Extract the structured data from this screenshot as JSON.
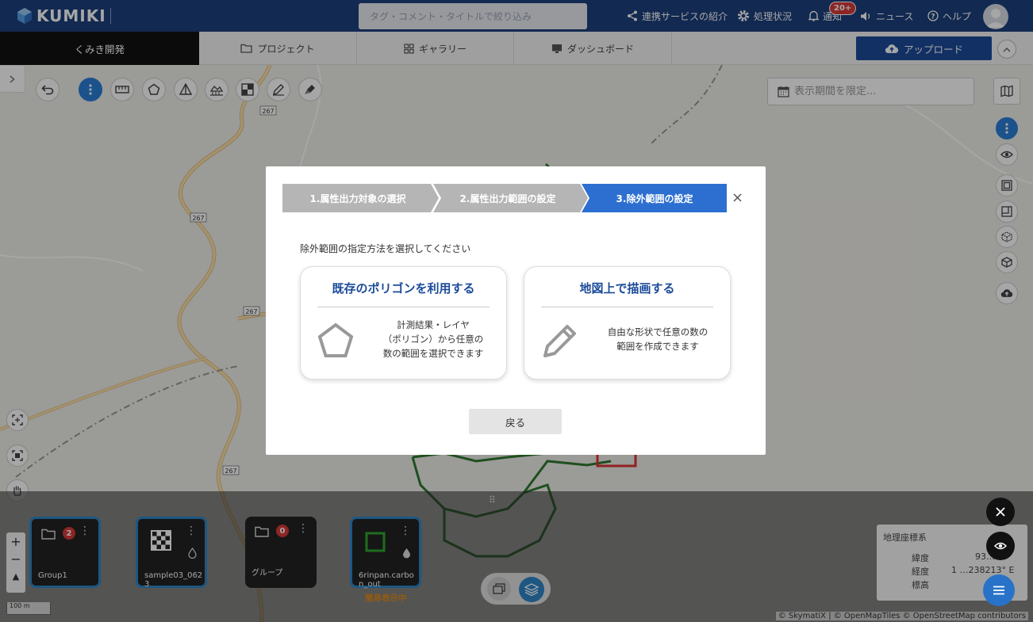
{
  "header": {
    "brand": "KUMIKI",
    "search_placeholder": "タグ・コメント・タイトルで絞り込み",
    "nav": {
      "services": "連携サービスの紹介",
      "status": "処理状況",
      "notifications": "通知",
      "notifications_badge": "20+",
      "news": "ニュース",
      "help": "ヘルプ"
    }
  },
  "tabs": {
    "project_name": "くみき開発",
    "project": "プロジェクト",
    "gallery": "ギャラリー",
    "dashboard": "ダッシュボード",
    "upload": "アップロード"
  },
  "map": {
    "date_placeholder": "表示期間を限定...",
    "road_labels": [
      "267",
      "267",
      "267",
      "267"
    ],
    "simple_display": "簡易表示中",
    "attribution": "© SkymatiX | © OpenMapTiles © OpenStreetMap contributors",
    "scale": "100 m"
  },
  "layers": [
    {
      "name": "Group1",
      "badge": "2",
      "type": "folder-icon",
      "selected": true
    },
    {
      "name": "sample03_0623",
      "badge": "",
      "type": "raster-icon",
      "selected": true
    },
    {
      "name": "グループ",
      "badge": "0",
      "type": "folder-icon",
      "selected": false
    },
    {
      "name": "6rinpan.carbon_out",
      "badge": "",
      "type": "polygon-layer-icon",
      "selected": true
    }
  ],
  "coords": {
    "title": "地理座標系",
    "lat_label": "緯度",
    "lat_value": "93…N",
    "lon_label": "経度",
    "lon_value": "1 …238213° E",
    "alt_label": "標高"
  },
  "modal": {
    "steps": [
      "1.属性出力対象の選択",
      "2.属性出力範囲の設定",
      "3.除外範囲の設定"
    ],
    "active_step": 2,
    "prompt": "除外範囲の指定方法を選択してください",
    "options": [
      {
        "title": "既存のポリゴンを利用する",
        "desc_lines": [
          "計測結果・レイヤ",
          "（ポリゴン）から任意の",
          "数の範囲を選択できます"
        ]
      },
      {
        "title": "地図上で描画する",
        "desc_lines": [
          "自由な形状で任意の数の",
          "範囲を作成できます"
        ]
      }
    ],
    "back": "戻る"
  },
  "colors": {
    "header_bg": "#1c3f7d",
    "accent": "#1c4b9a",
    "active_step": "#2d6fd1",
    "inactive_step": "#b5b5b5",
    "card_select": "#2d86c8",
    "badge": "#d83a3a"
  }
}
